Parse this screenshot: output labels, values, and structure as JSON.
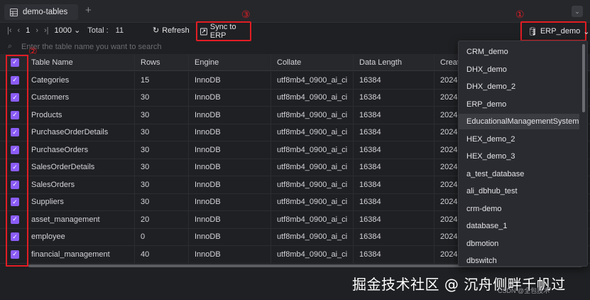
{
  "tab": {
    "title": "demo-tables",
    "add_label": "+"
  },
  "pager": {
    "page": "1",
    "page_size": "1000",
    "total_label": "Total :",
    "total": "11"
  },
  "toolbar": {
    "refresh_label": "Refresh",
    "sync_label": "Sync to ERP"
  },
  "db_select": {
    "value": "ERP_demo"
  },
  "annotations": {
    "one": "①",
    "two": "②",
    "three": "③"
  },
  "search": {
    "placeholder": "Enter the table name you want to search"
  },
  "columns": [
    "Table Name",
    "Rows",
    "Engine",
    "Collate",
    "Data Length",
    "Create"
  ],
  "rows": [
    {
      "name": "Categories",
      "rows": "15",
      "engine": "InnoDB",
      "collate": "utf8mb4_0900_ai_ci",
      "data_length": "16384",
      "create": "2024"
    },
    {
      "name": "Customers",
      "rows": "30",
      "engine": "InnoDB",
      "collate": "utf8mb4_0900_ai_ci",
      "data_length": "16384",
      "create": "2024"
    },
    {
      "name": "Products",
      "rows": "30",
      "engine": "InnoDB",
      "collate": "utf8mb4_0900_ai_ci",
      "data_length": "16384",
      "create": "2024"
    },
    {
      "name": "PurchaseOrderDetails",
      "rows": "30",
      "engine": "InnoDB",
      "collate": "utf8mb4_0900_ai_ci",
      "data_length": "16384",
      "create": "2024"
    },
    {
      "name": "PurchaseOrders",
      "rows": "30",
      "engine": "InnoDB",
      "collate": "utf8mb4_0900_ai_ci",
      "data_length": "16384",
      "create": "2024"
    },
    {
      "name": "SalesOrderDetails",
      "rows": "30",
      "engine": "InnoDB",
      "collate": "utf8mb4_0900_ai_ci",
      "data_length": "16384",
      "create": "2024"
    },
    {
      "name": "SalesOrders",
      "rows": "30",
      "engine": "InnoDB",
      "collate": "utf8mb4_0900_ai_ci",
      "data_length": "16384",
      "create": "2024"
    },
    {
      "name": "Suppliers",
      "rows": "30",
      "engine": "InnoDB",
      "collate": "utf8mb4_0900_ai_ci",
      "data_length": "16384",
      "create": "2024"
    },
    {
      "name": "asset_management",
      "rows": "20",
      "engine": "InnoDB",
      "collate": "utf8mb4_0900_ai_ci",
      "data_length": "16384",
      "create": "2024"
    },
    {
      "name": "employee",
      "rows": "0",
      "engine": "InnoDB",
      "collate": "utf8mb4_0900_ai_ci",
      "data_length": "16384",
      "create": "2024"
    },
    {
      "name": "financial_management",
      "rows": "40",
      "engine": "InnoDB",
      "collate": "utf8mb4_0900_ai_ci",
      "data_length": "16384",
      "create": "2024"
    }
  ],
  "dropdown": {
    "items": [
      "CRM_demo",
      "DHX_demo",
      "DHX_demo_2",
      "ERP_demo",
      "EducationalManagementSystem",
      "HEX_demo_2",
      "HEX_demo_3",
      "a_test_database",
      "ali_dbhub_test",
      "crm-demo",
      "database_1",
      "dbmotion",
      "dbswitch"
    ],
    "highlighted": "EducationalManagementSystem"
  },
  "watermark": {
    "main": "掘金技术社区 @ 沉舟侧畔千帆过",
    "small": "CSDN @全包技术"
  },
  "colors": {
    "accent": "#8b5cf6",
    "annotation": "#e11d24"
  }
}
